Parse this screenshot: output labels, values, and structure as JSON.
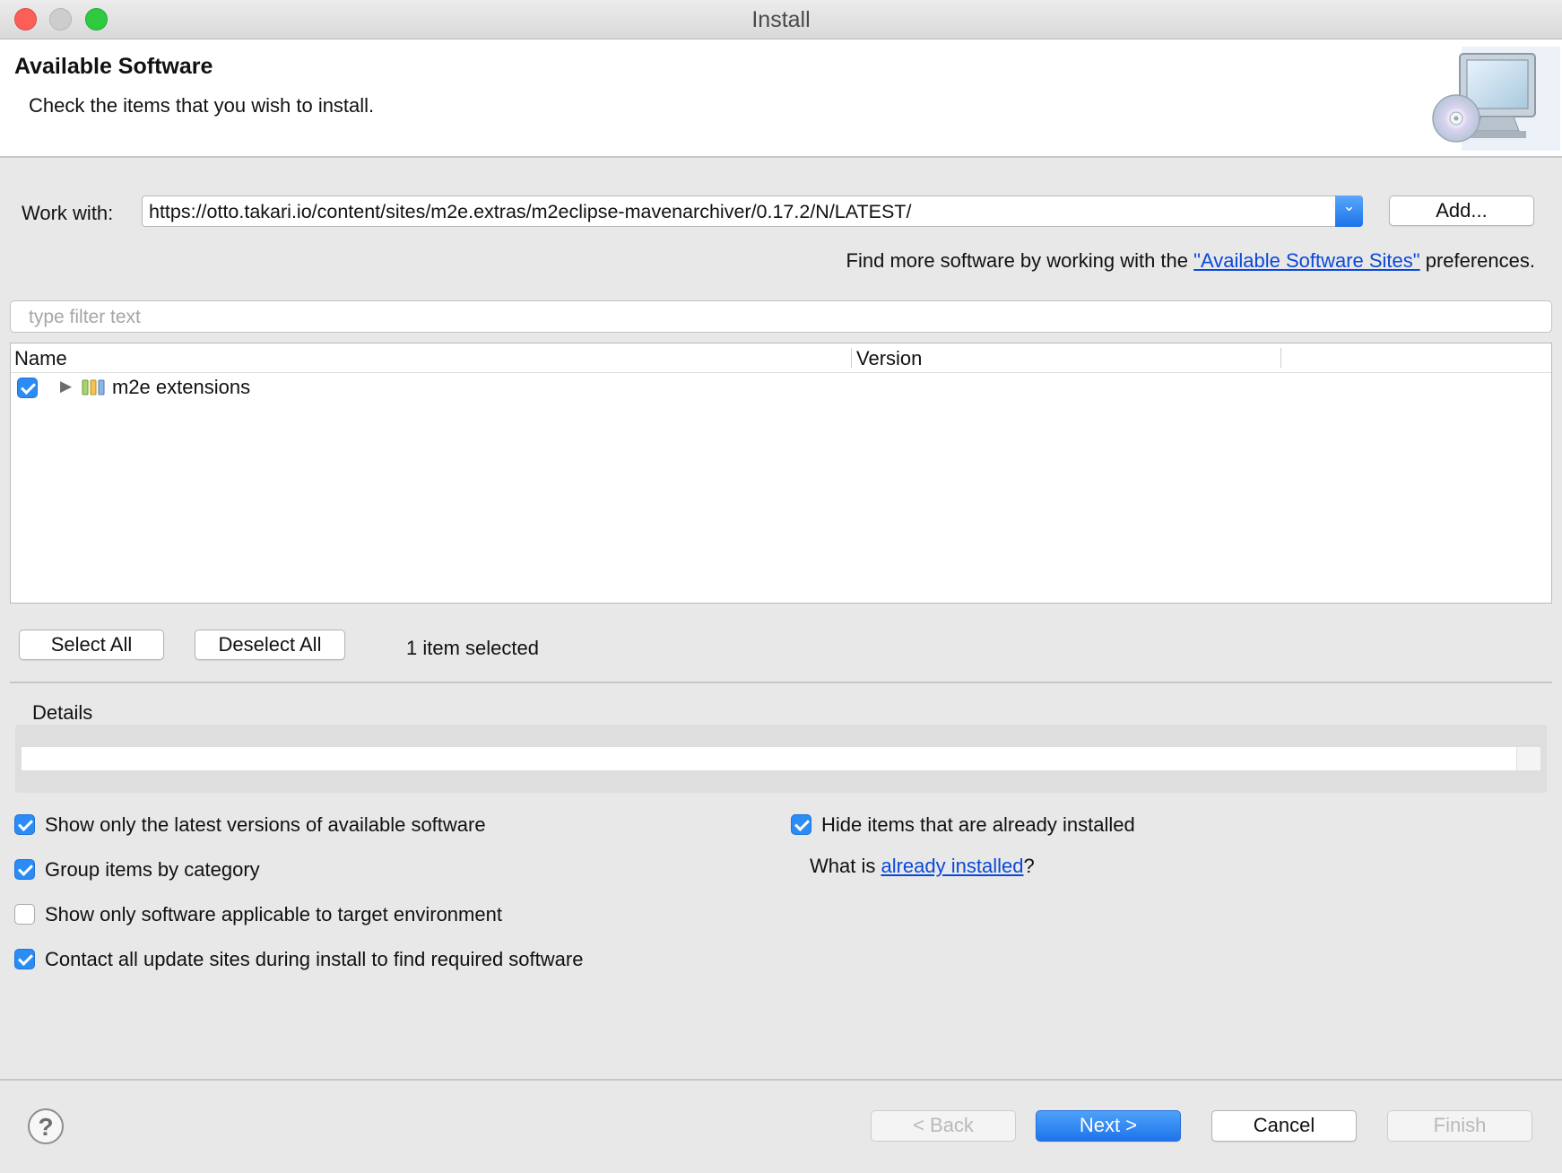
{
  "window": {
    "title": "Install"
  },
  "header": {
    "title": "Available Software",
    "description": "Check the items that you wish to install."
  },
  "work_with": {
    "label": "Work with:",
    "value": "https://otto.takari.io/content/sites/m2e.extras/m2eclipse-mavenarchiver/0.17.2/N/LATEST/",
    "add_label": "Add...",
    "more_prefix": "Find more software by working with the ",
    "more_link": "\"Available Software Sites\"",
    "more_suffix": " preferences."
  },
  "filter": {
    "placeholder": "type filter text"
  },
  "tree": {
    "columns": [
      "Name",
      "Version"
    ],
    "items": [
      {
        "label": "m2e extensions",
        "checked": true,
        "version": ""
      }
    ]
  },
  "selection": {
    "select_all": "Select All",
    "deselect_all": "Deselect All",
    "count_text": "1 item selected"
  },
  "details": {
    "label": "Details"
  },
  "options": {
    "latest_only": "Show only the latest versions of available software",
    "group_by_category": "Group items by category",
    "target_env": "Show only software applicable to target environment",
    "contact_sites": "Contact all update sites during install to find required software",
    "hide_installed": "Hide items that are already installed",
    "what_is_prefix": "What is ",
    "what_is_link": "already installed",
    "what_is_suffix": "?"
  },
  "footer": {
    "help": "?",
    "back": "< Back",
    "next": "Next >",
    "cancel": "Cancel",
    "finish": "Finish"
  },
  "colors": {
    "accent": "#2b8cf5",
    "link": "#0b48d9"
  }
}
